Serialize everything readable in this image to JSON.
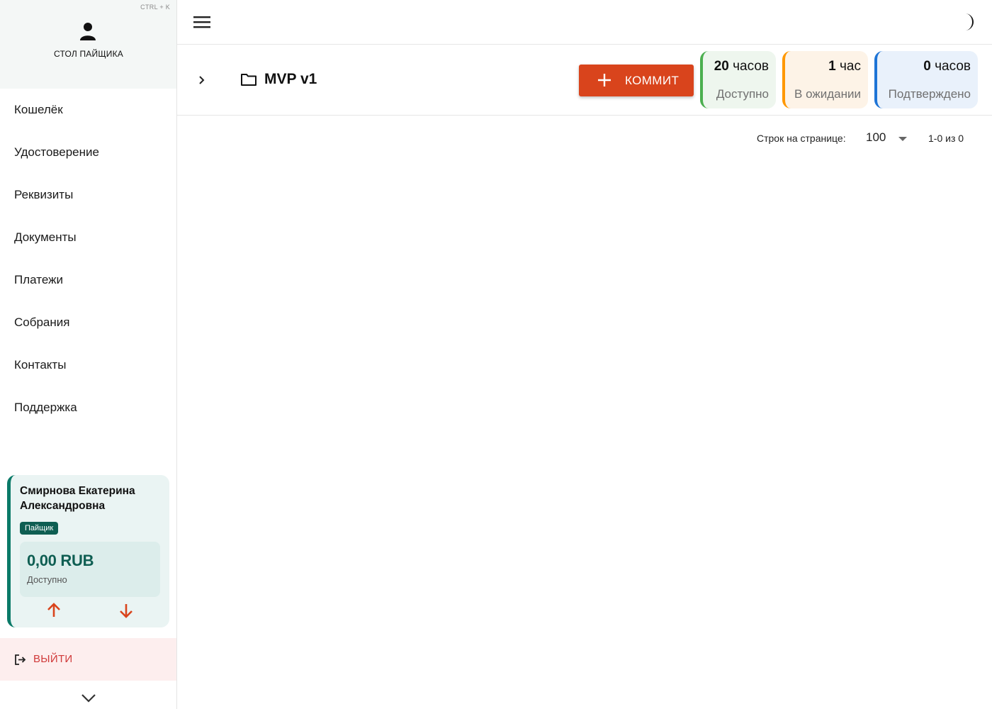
{
  "sidebar": {
    "shortcut": "CTRL + K",
    "title": "СТОЛ ПАЙЩИКА",
    "items": [
      {
        "label": "Кошелёк"
      },
      {
        "label": "Удостоверение"
      },
      {
        "label": "Реквизиты"
      },
      {
        "label": "Документы"
      },
      {
        "label": "Платежи"
      },
      {
        "label": "Собрания"
      },
      {
        "label": "Контакты"
      },
      {
        "label": "Поддержка"
      }
    ],
    "user_card": {
      "name": "Смирнова Екатерина Александровна",
      "role": "Пайщик",
      "balance": "0,00 RUB",
      "balance_label": "Доступно"
    },
    "logout_label": "ВЫЙТИ"
  },
  "project": {
    "title": "MVP v1",
    "commit_label": "КОММИТ"
  },
  "stats": [
    {
      "number": "20",
      "unit": " часов",
      "label": "Доступно",
      "accent": "#4caf50",
      "bg": "#eef6ee"
    },
    {
      "number": "1",
      "unit": " час",
      "label": "В ожидании",
      "accent": "#ff9800",
      "bg": "#fdf3e7"
    },
    {
      "number": "0",
      "unit": " часов",
      "label": "Подтверждено",
      "accent": "#1e74d6",
      "bg": "#e9f1fb"
    }
  ],
  "pagination": {
    "rows_label": "Строк на странице:",
    "rows_value": "100",
    "range": "1-0 из 0"
  },
  "colors": {
    "brand": "#0e5e52",
    "commit_button": "#d9441c",
    "logout_text": "#d03a3a"
  },
  "icons": {
    "user": "user-icon",
    "menu": "menu-icon",
    "theme": "moon-icon",
    "folder": "folder-icon",
    "expand": "chevron-right-icon",
    "add": "plus-icon",
    "deposit": "arrow-up-icon",
    "withdraw": "arrow-down-icon",
    "logout": "logout-icon",
    "collapse": "chevron-down-icon"
  }
}
